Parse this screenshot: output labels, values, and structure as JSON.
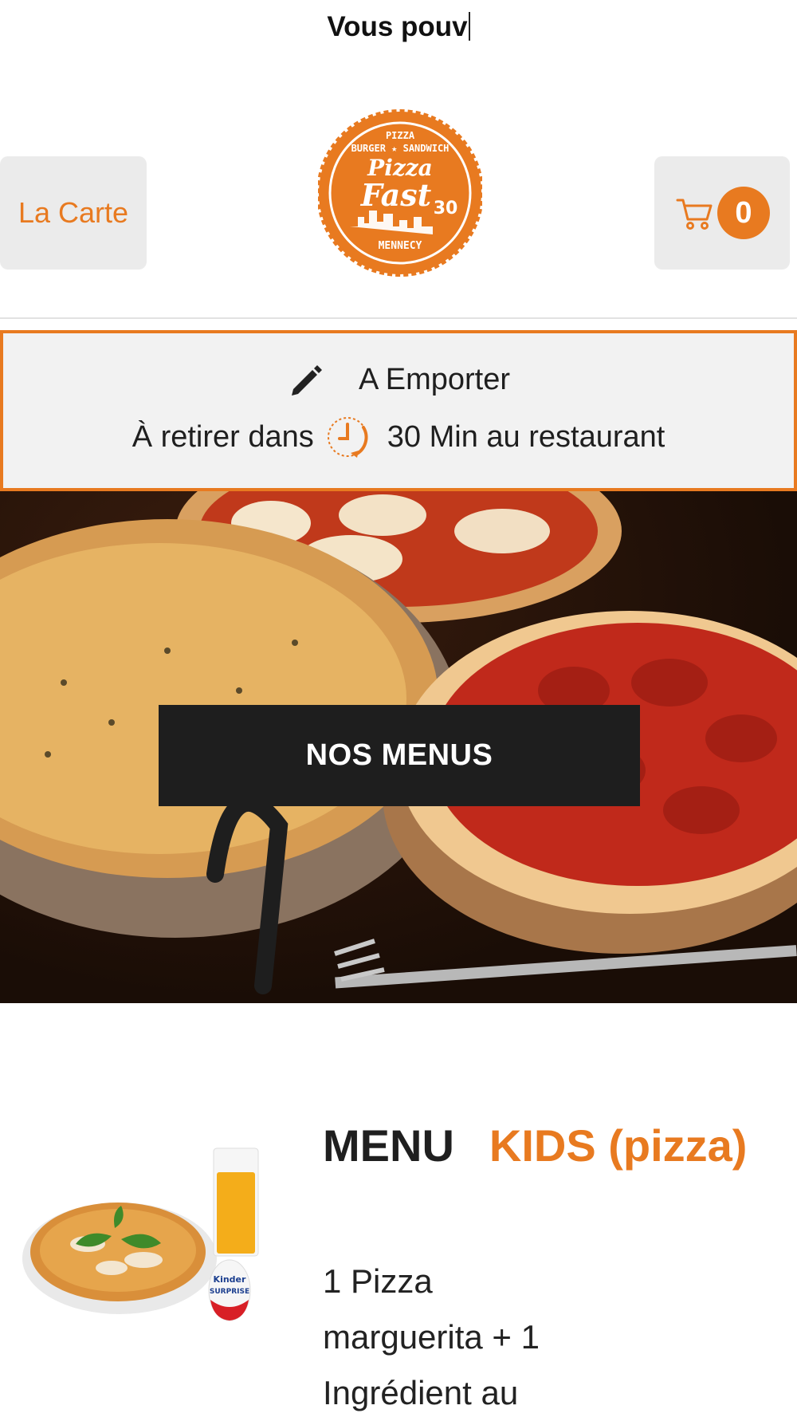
{
  "search": {
    "typed_text": "Vous pouv"
  },
  "header": {
    "carte_label": "La Carte",
    "cart_count": "0",
    "logo": {
      "top": "PIZZA",
      "subtitle": "BURGER ★ SANDWICH",
      "brand1": "Pizza",
      "brand2": "Fast",
      "number": "30",
      "city": "MENNECY"
    }
  },
  "takeaway": {
    "mode": "A Emporter",
    "pickup_prefix": "À retirer dans",
    "pickup_suffix": "30 Min au restaurant"
  },
  "hero": {
    "button_label": "NOS MENUS"
  },
  "product": {
    "title_part1": "MENU",
    "title_part2": "KIDS (pizza)",
    "description_lines": [
      "1 Pizza",
      "marguerita + 1",
      "Ingrédient au"
    ],
    "egg_brand": "Kinder",
    "egg_label": "SURPRISE"
  },
  "colors": {
    "accent": "#e87a20",
    "dark_button": "#1e1e1e",
    "panel": "#f2f2f2"
  }
}
